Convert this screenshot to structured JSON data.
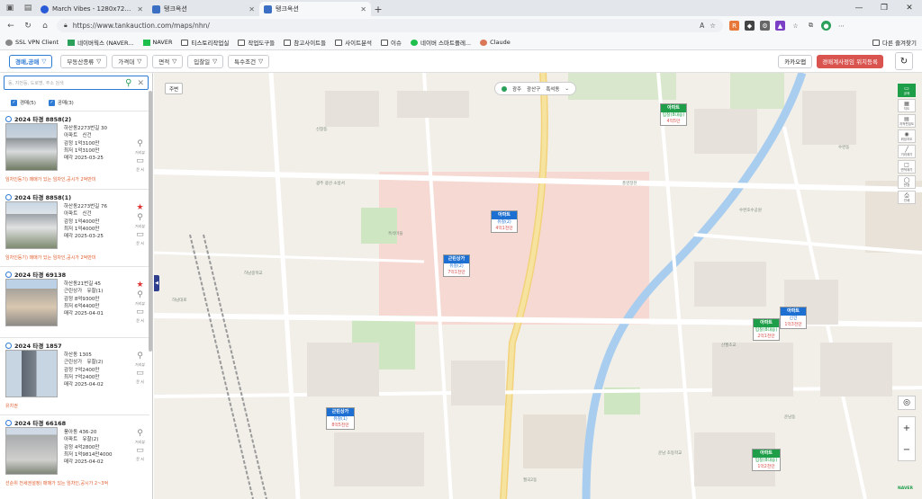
{
  "browser": {
    "tabs": [
      {
        "label": "March Vibes - 1280x720 px - Co",
        "color": "#2a5bd7",
        "active": false
      },
      {
        "label": "탱크옥션",
        "color": "#3a6fc4",
        "active": false
      },
      {
        "label": "탱크옥션",
        "color": "#3a6fc4",
        "active": true
      }
    ],
    "url": "https://www.tankauction.com/maps/nhn/",
    "bookmarks": [
      "SSL VPN Client",
      "네이버웍스 (NAVER...",
      "NAVER",
      "티스토리작업실",
      "작업도구들",
      "참고사이트들",
      "사이트분석",
      "이슈",
      "네이버 스마트플레...",
      "Claude"
    ],
    "other_bookmarks": "다른 즐겨찾기"
  },
  "filters": {
    "items": [
      "경매,공매",
      "부동산종류",
      "가격대",
      "면적",
      "입찰일",
      "특수조건"
    ],
    "kakao": "카카오맵",
    "red_button": "경매계사정임 위치등록"
  },
  "sidebar": {
    "search_placeholder": "동, 지번등, 도로명, 주소 검색",
    "checks": [
      "경매(5)",
      "공매(3)"
    ],
    "listings": [
      {
        "case": "2024 타경 8858(2)",
        "addr": "하산동2273번길 30",
        "type": "아파트",
        "status": "신건",
        "appraisal": "감정 1억3100만",
        "minimum": "최저 1억3100만",
        "date": "매각 2025-03-25",
        "note": "임차인등기) 매매가 있는 임차인,공시가 2억만미",
        "starred": false
      },
      {
        "case": "2024 타경 8858(1)",
        "addr": "하산동2273번길 76",
        "type": "아파트",
        "status": "신건",
        "appraisal": "감정 1억4000만",
        "minimum": "최저 1억4000만",
        "date": "매각 2025-03-25",
        "note": "임차인등기) 매매가 있는 임차인,공시가 2억만미",
        "starred": true
      },
      {
        "case": "2024 타경 69138",
        "addr": "하산동21번길 45",
        "type": "근린상가",
        "status": "유찰(1)",
        "appraisal": "감정 8억9300만",
        "minimum": "최저 6억4400만",
        "date": "매각 2025-04-01",
        "note": "",
        "starred": true
      },
      {
        "case": "2024 타경 1857",
        "addr": "하산동 1305",
        "type": "근린상가",
        "status": "유찰(2)",
        "appraisal": "감정 7억2400만",
        "minimum": "최저 7억2400만",
        "date": "매각 2025-04-02",
        "note": "유치권",
        "starred": false
      },
      {
        "case": "2024 타경 66168",
        "addr": "풍아동 436-20",
        "type": "아파트",
        "status": "유찰(2)",
        "appraisal": "감정 4억2800만",
        "minimum": "최저 1억9814만4000",
        "date": "매각 2025-04-02",
        "note": "선순위 전세권설정) 매매가 있는 임차인,공시가 2~3억",
        "starred": false
      }
    ],
    "icon_labels": [
      "거리뷰",
      "문 서"
    ]
  },
  "map": {
    "region_button": "주변",
    "location": [
      "광주",
      "광산구",
      "흑석동"
    ],
    "markers": [
      {
        "title": "아파트",
        "l2": "입찰(8대응)",
        "l3": "4억5만",
        "color": "green"
      },
      {
        "title": "아파트",
        "l2": "유찰(2)",
        "l3": "4억1천만",
        "color": "blue"
      },
      {
        "title": "근린상가",
        "l2": "유찰(2)",
        "l3": "7억1천만",
        "color": "blue"
      },
      {
        "title": "아파트",
        "l2": "입찰(8대응)",
        "l3": "2억1천만",
        "color": "green"
      },
      {
        "title": "아파트",
        "l2": "신건",
        "l3": "1억3천만",
        "color": "blue"
      },
      {
        "title": "근린상가",
        "l2": "유찰(1)",
        "l3": "8억5천만",
        "color": "blue"
      },
      {
        "title": "아파트",
        "l2": "입찰(8대응)",
        "l3": "1억2천만",
        "color": "green"
      }
    ],
    "tools": [
      "공매",
      "지도",
      "지적편집도",
      "위성지도",
      "거리재기",
      "면적재기",
      "반경",
      "인쇄"
    ],
    "naver": "NAVER",
    "labels": [
      "광주 광산 소방서",
      "흑석마을",
      "운남 초등학교",
      "산월초교",
      "수완호수공원",
      "풍영정천",
      "운남동",
      "월곡2동",
      "하남중학교",
      "신창동",
      "하남대로",
      "수완동"
    ]
  }
}
